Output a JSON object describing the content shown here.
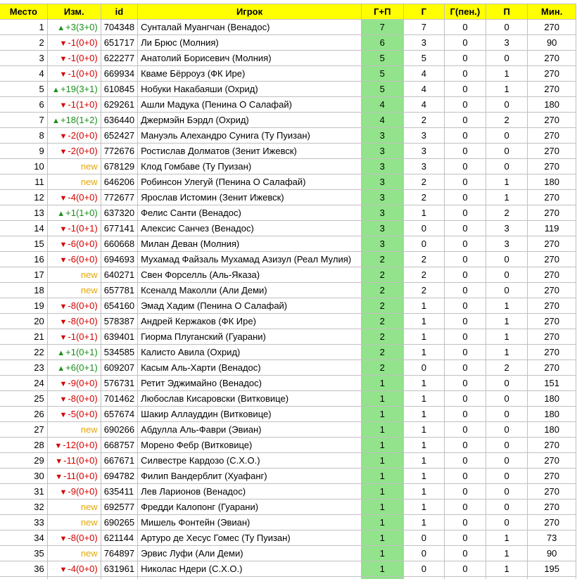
{
  "headers": [
    "Место",
    "Изм.",
    "id",
    "Игрок",
    "Г+П",
    "Г",
    "Г(пен.)",
    "П",
    "Мин."
  ],
  "colors": {
    "header_bg": "#ffff00",
    "gp_bg": "#92e38b",
    "up": "#1a8f1a",
    "down": "#d40000",
    "new": "#e6a800"
  },
  "rows": [
    {
      "place": "1",
      "chg": "+3(3+0)",
      "dir": "up",
      "id": "704348",
      "player": "Сунталай Муангчан (Венадос)",
      "gp": "7",
      "g": "7",
      "gpen": "0",
      "p": "0",
      "min": "270"
    },
    {
      "place": "2",
      "chg": "-1(0+0)",
      "dir": "down",
      "id": "651717",
      "player": "Ли Брюс (Молния)",
      "gp": "6",
      "g": "3",
      "gpen": "0",
      "p": "3",
      "min": "90"
    },
    {
      "place": "3",
      "chg": "-1(0+0)",
      "dir": "down",
      "id": "622277",
      "player": "Анатолий Борисевич (Молния)",
      "gp": "5",
      "g": "5",
      "gpen": "0",
      "p": "0",
      "min": "270"
    },
    {
      "place": "4",
      "chg": "-1(0+0)",
      "dir": "down",
      "id": "669934",
      "player": "Кваме Бёрроуз (ФК Ире)",
      "gp": "5",
      "g": "4",
      "gpen": "0",
      "p": "1",
      "min": "270"
    },
    {
      "place": "5",
      "chg": "+19(3+1)",
      "dir": "up",
      "id": "610845",
      "player": "Нобуки Накабаяши (Охрид)",
      "gp": "5",
      "g": "4",
      "gpen": "0",
      "p": "1",
      "min": "270"
    },
    {
      "place": "6",
      "chg": "-1(1+0)",
      "dir": "down",
      "id": "629261",
      "player": "Ашли Мадука (Пенина О Салафай)",
      "gp": "4",
      "g": "4",
      "gpen": "0",
      "p": "0",
      "min": "180"
    },
    {
      "place": "7",
      "chg": "+18(1+2)",
      "dir": "up",
      "id": "636440",
      "player": "Джермэйн Бэрдл (Охрид)",
      "gp": "4",
      "g": "2",
      "gpen": "0",
      "p": "2",
      "min": "270"
    },
    {
      "place": "8",
      "chg": "-2(0+0)",
      "dir": "down",
      "id": "652427",
      "player": "Мануэль Алехандро Сунига (Ту Пуизан)",
      "gp": "3",
      "g": "3",
      "gpen": "0",
      "p": "0",
      "min": "270"
    },
    {
      "place": "9",
      "chg": "-2(0+0)",
      "dir": "down",
      "id": "772676",
      "player": "Ростислав Долматов (Зенит Ижевск)",
      "gp": "3",
      "g": "3",
      "gpen": "0",
      "p": "0",
      "min": "270"
    },
    {
      "place": "10",
      "chg": "new",
      "dir": "new",
      "id": "678129",
      "player": "Клод Гомбаве (Ту Пуизан)",
      "gp": "3",
      "g": "3",
      "gpen": "0",
      "p": "0",
      "min": "270"
    },
    {
      "place": "11",
      "chg": "new",
      "dir": "new",
      "id": "646206",
      "player": "Робинсон Улегуй (Пенина О Салафай)",
      "gp": "3",
      "g": "2",
      "gpen": "0",
      "p": "1",
      "min": "180"
    },
    {
      "place": "12",
      "chg": "-4(0+0)",
      "dir": "down",
      "id": "772677",
      "player": "Ярослав Истомин (Зенит Ижевск)",
      "gp": "3",
      "g": "2",
      "gpen": "0",
      "p": "1",
      "min": "270"
    },
    {
      "place": "13",
      "chg": "+1(1+0)",
      "dir": "up",
      "id": "637320",
      "player": "Фелис Санти (Венадос)",
      "gp": "3",
      "g": "1",
      "gpen": "0",
      "p": "2",
      "min": "270"
    },
    {
      "place": "14",
      "chg": "-1(0+1)",
      "dir": "down",
      "id": "677141",
      "player": "Алексис Санчез (Венадос)",
      "gp": "3",
      "g": "0",
      "gpen": "0",
      "p": "3",
      "min": "119"
    },
    {
      "place": "15",
      "chg": "-6(0+0)",
      "dir": "down",
      "id": "660668",
      "player": "Милан Деван (Молния)",
      "gp": "3",
      "g": "0",
      "gpen": "0",
      "p": "3",
      "min": "270"
    },
    {
      "place": "16",
      "chg": "-6(0+0)",
      "dir": "down",
      "id": "694693",
      "player": "Мухамад Файзаль Мухамад Азизул (Реал Мулия)",
      "gp": "2",
      "g": "2",
      "gpen": "0",
      "p": "0",
      "min": "270"
    },
    {
      "place": "17",
      "chg": "new",
      "dir": "new",
      "id": "640271",
      "player": "Свен Форселль (Аль-Яказа)",
      "gp": "2",
      "g": "2",
      "gpen": "0",
      "p": "0",
      "min": "270"
    },
    {
      "place": "18",
      "chg": "new",
      "dir": "new",
      "id": "657781",
      "player": "Ксеналд Маколли (Али Деми)",
      "gp": "2",
      "g": "2",
      "gpen": "0",
      "p": "0",
      "min": "270"
    },
    {
      "place": "19",
      "chg": "-8(0+0)",
      "dir": "down",
      "id": "654160",
      "player": "Эмад Хадим (Пенина О Салафай)",
      "gp": "2",
      "g": "1",
      "gpen": "0",
      "p": "1",
      "min": "270"
    },
    {
      "place": "20",
      "chg": "-8(0+0)",
      "dir": "down",
      "id": "578387",
      "player": "Андрей Кержаков (ФК Ире)",
      "gp": "2",
      "g": "1",
      "gpen": "0",
      "p": "1",
      "min": "270"
    },
    {
      "place": "21",
      "chg": "-1(0+1)",
      "dir": "down",
      "id": "639401",
      "player": "Гиорма Плуганский (Гуарани)",
      "gp": "2",
      "g": "1",
      "gpen": "0",
      "p": "1",
      "min": "270"
    },
    {
      "place": "22",
      "chg": "+1(0+1)",
      "dir": "up",
      "id": "534585",
      "player": "Калисто Авила (Охрид)",
      "gp": "2",
      "g": "1",
      "gpen": "0",
      "p": "1",
      "min": "270"
    },
    {
      "place": "23",
      "chg": "+6(0+1)",
      "dir": "up",
      "id": "609207",
      "player": "Касым Аль-Харти (Венадос)",
      "gp": "2",
      "g": "0",
      "gpen": "0",
      "p": "2",
      "min": "270"
    },
    {
      "place": "24",
      "chg": "-9(0+0)",
      "dir": "down",
      "id": "576731",
      "player": "Ретит Эджимайно (Венадос)",
      "gp": "1",
      "g": "1",
      "gpen": "0",
      "p": "0",
      "min": "151"
    },
    {
      "place": "25",
      "chg": "-8(0+0)",
      "dir": "down",
      "id": "701462",
      "player": "Любослав Кисаровски (Витковице)",
      "gp": "1",
      "g": "1",
      "gpen": "0",
      "p": "0",
      "min": "180"
    },
    {
      "place": "26",
      "chg": "-5(0+0)",
      "dir": "down",
      "id": "657674",
      "player": "Шакир Аллауддин (Витковице)",
      "gp": "1",
      "g": "1",
      "gpen": "0",
      "p": "0",
      "min": "180"
    },
    {
      "place": "27",
      "chg": "new",
      "dir": "new",
      "id": "690266",
      "player": "Абдулла Аль-Фаври (Эвиан)",
      "gp": "1",
      "g": "1",
      "gpen": "0",
      "p": "0",
      "min": "180"
    },
    {
      "place": "28",
      "chg": "-12(0+0)",
      "dir": "down",
      "id": "668757",
      "player": "Морено Фебр (Витковице)",
      "gp": "1",
      "g": "1",
      "gpen": "0",
      "p": "0",
      "min": "270"
    },
    {
      "place": "29",
      "chg": "-11(0+0)",
      "dir": "down",
      "id": "667671",
      "player": "Силвестре Кардозо (С.Х.О.)",
      "gp": "1",
      "g": "1",
      "gpen": "0",
      "p": "0",
      "min": "270"
    },
    {
      "place": "30",
      "chg": "-11(0+0)",
      "dir": "down",
      "id": "694782",
      "player": "Филип Вандерблит (Хуафанг)",
      "gp": "1",
      "g": "1",
      "gpen": "0",
      "p": "0",
      "min": "270"
    },
    {
      "place": "31",
      "chg": "-9(0+0)",
      "dir": "down",
      "id": "635411",
      "player": "Лев Ларионов (Венадос)",
      "gp": "1",
      "g": "1",
      "gpen": "0",
      "p": "0",
      "min": "270"
    },
    {
      "place": "32",
      "chg": "new",
      "dir": "new",
      "id": "692577",
      "player": "Фредди Калопонг (Гуарани)",
      "gp": "1",
      "g": "1",
      "gpen": "0",
      "p": "0",
      "min": "270"
    },
    {
      "place": "33",
      "chg": "new",
      "dir": "new",
      "id": "690265",
      "player": "Мишель Фонтейн (Эвиан)",
      "gp": "1",
      "g": "1",
      "gpen": "0",
      "p": "0",
      "min": "270"
    },
    {
      "place": "34",
      "chg": "-8(0+0)",
      "dir": "down",
      "id": "621144",
      "player": "Артуро де Хесус Гомес (Ту Пуизан)",
      "gp": "1",
      "g": "0",
      "gpen": "0",
      "p": "1",
      "min": "73"
    },
    {
      "place": "35",
      "chg": "new",
      "dir": "new",
      "id": "764897",
      "player": "Эрвис Луфи (Али Деми)",
      "gp": "1",
      "g": "0",
      "gpen": "0",
      "p": "1",
      "min": "90"
    },
    {
      "place": "36",
      "chg": "-4(0+0)",
      "dir": "down",
      "id": "631961",
      "player": "Николас Ндери (С.Х.О.)",
      "gp": "1",
      "g": "0",
      "gpen": "0",
      "p": "1",
      "min": "195"
    }
  ]
}
